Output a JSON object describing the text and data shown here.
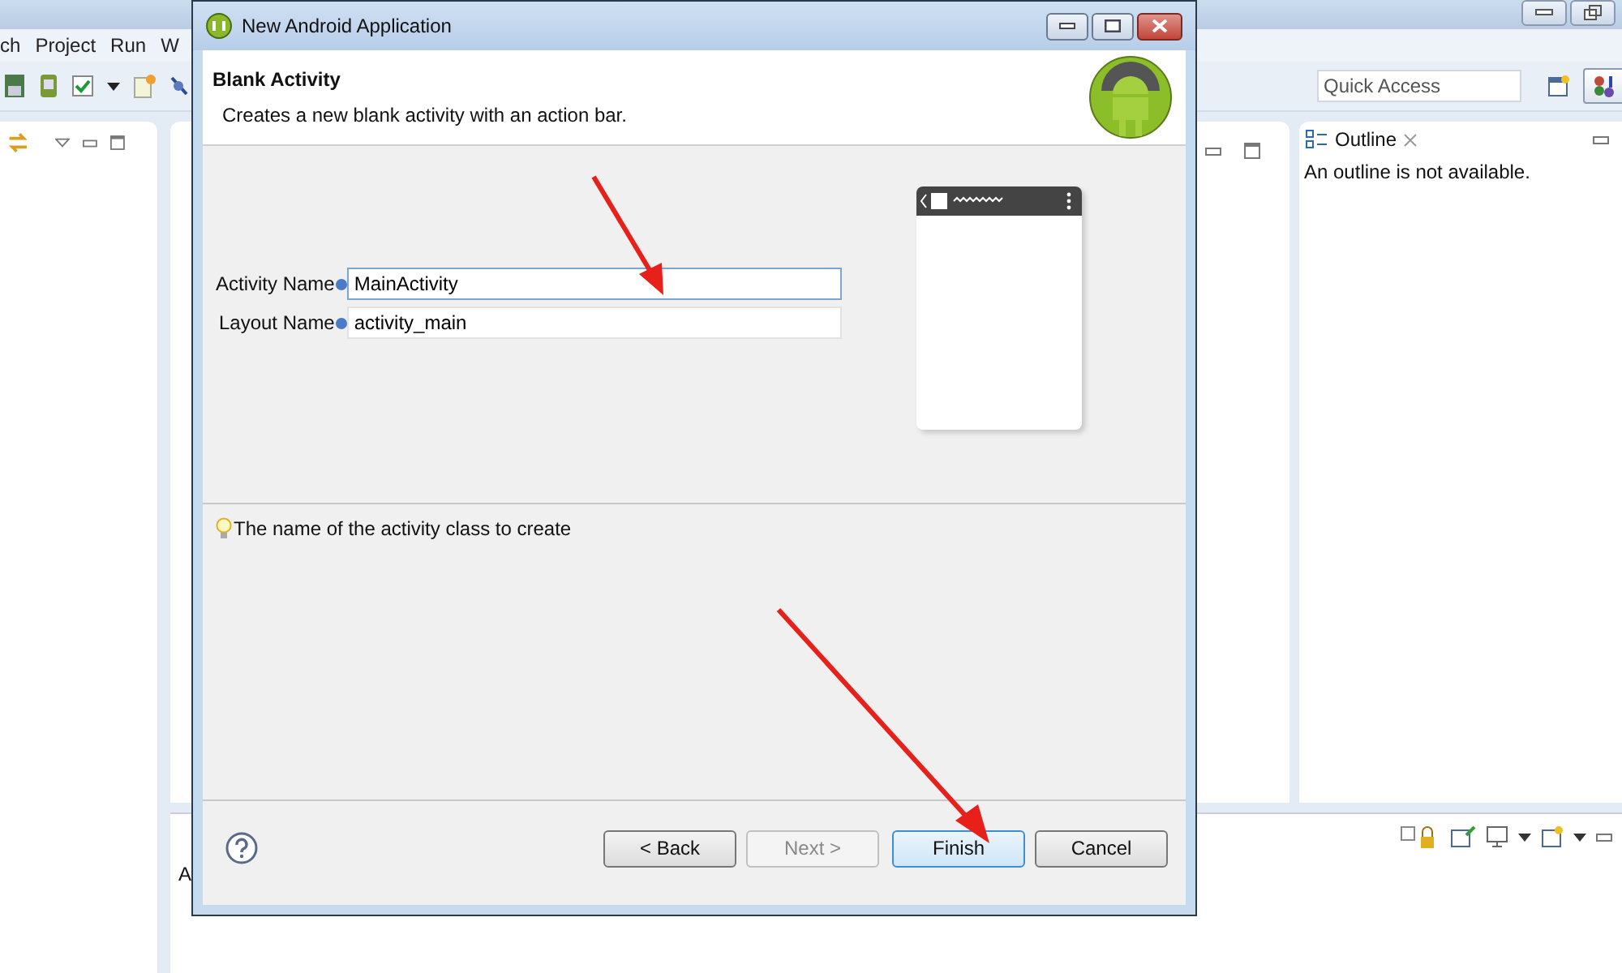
{
  "ide": {
    "menu": [
      "ch",
      "Project",
      "Run",
      "W"
    ],
    "quick_access": {
      "placeholder": "Quick Access"
    },
    "outline": {
      "tab": "Outline",
      "message": "An outline is not available."
    },
    "bottom_panel": {
      "text": "A"
    }
  },
  "dialog": {
    "title": "New Android Application",
    "header": {
      "title": "Blank Activity",
      "description": "Creates a new blank activity with an action bar."
    },
    "fields": [
      {
        "label": "Activity Name",
        "value": "MainActivity",
        "focused": true
      },
      {
        "label": "Layout Name",
        "value": "activity_main",
        "focused": false
      }
    ],
    "hint": "The name of the activity class to create",
    "buttons": [
      {
        "label": "< Back",
        "disabled": false,
        "default": false
      },
      {
        "label": "Next >",
        "disabled": true,
        "default": false
      },
      {
        "label": "Finish",
        "disabled": false,
        "default": true
      },
      {
        "label": "Cancel",
        "disabled": false,
        "default": false
      }
    ]
  }
}
